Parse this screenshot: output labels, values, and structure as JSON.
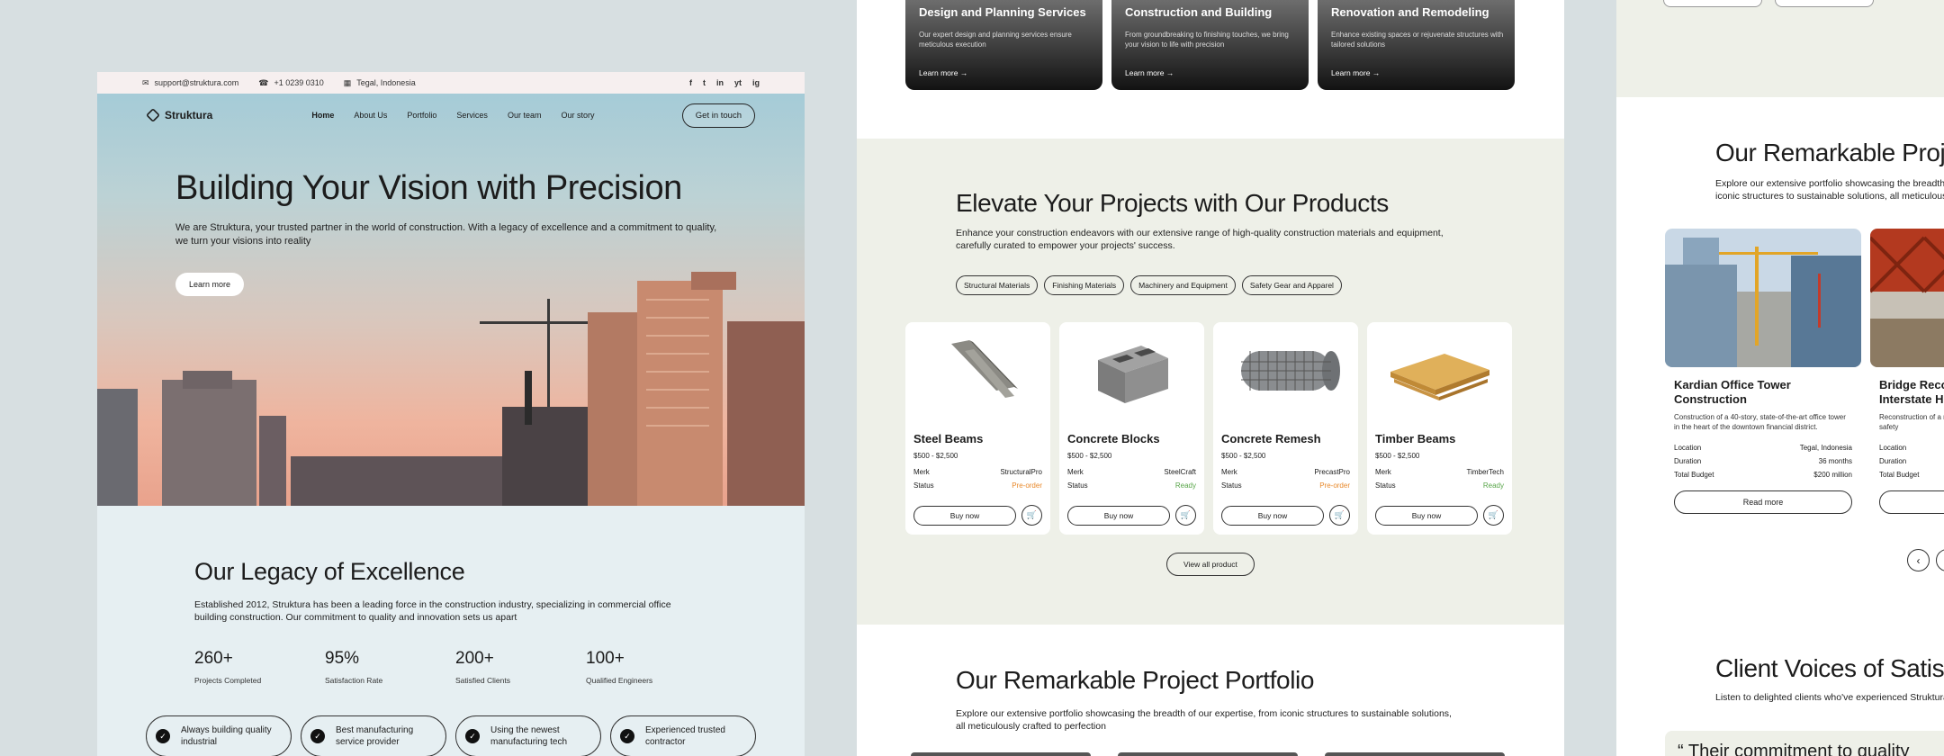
{
  "hero_page": {
    "topbar": {
      "email": "support@struktura.com",
      "phone": "+1 0239 0310",
      "location": "Tegal, Indonesia",
      "socials": [
        "f",
        "t",
        "in",
        "yt",
        "ig"
      ]
    },
    "nav": {
      "brand": "Struktura",
      "links": [
        "Home",
        "About Us",
        "Portfolio",
        "Services",
        "Our team",
        "Our story"
      ],
      "cta": "Get in touch"
    },
    "hero": {
      "title": "Building Your Vision with Precision",
      "subtitle": "We are Struktura, your trusted partner in the world of construction. With a legacy of excellence and a commitment to quality, we turn your visions into reality",
      "button": "Learn more"
    },
    "legacy": {
      "title": "Our Legacy of Excellence",
      "description": "Established 2012, Struktura has been a leading force in the construction industry, specializing in commercial office building construction. Our commitment to quality and innovation sets us apart",
      "stats": [
        {
          "value": "260+",
          "label": "Projects Completed"
        },
        {
          "value": "95%",
          "label": "Satisfaction Rate"
        },
        {
          "value": "200+",
          "label": "Satisfied Clients"
        },
        {
          "value": "100+",
          "label": "Qualified Engineers"
        }
      ],
      "highlights": [
        "Always building quality industrial",
        "Best manufacturing service provider",
        "Using the newest manufacturing tech",
        "Experienced trusted contractor"
      ]
    }
  },
  "products_page": {
    "services": [
      {
        "title": "Design and Planning Services",
        "text": "Our expert design and planning services ensure meticulous execution",
        "more": "Learn more"
      },
      {
        "title": "Construction and Building",
        "text": "From groundbreaking to finishing touches, we bring your vision to life with precision",
        "more": "Learn more"
      },
      {
        "title": "Renovation and Remodeling",
        "text": "Enhance existing spaces or rejuvenate structures with tailored solutions",
        "more": "Learn more"
      }
    ],
    "title": "Elevate Your Projects with Our Products",
    "description": "Enhance your construction endeavors with our extensive range of high-quality construction materials and equipment, carefully curated to empower your projects' success.",
    "categories": [
      "Structural Materials",
      "Finishing Materials",
      "Machinery and Equipment",
      "Safety Gear and Apparel"
    ],
    "products": [
      {
        "name": "Steel Beams",
        "price": "$500 - $2,500",
        "merk": "StructuralPro",
        "status": "Pre-order",
        "status_color": "#e8892b"
      },
      {
        "name": "Concrete Blocks",
        "price": "$500 - $2,500",
        "merk": "SteelCraft",
        "status": "Ready",
        "status_color": "#5aa64b"
      },
      {
        "name": "Concrete Remesh",
        "price": "$500 - $2,500",
        "merk": "PrecastPro",
        "status": "Pre-order",
        "status_color": "#e8892b"
      },
      {
        "name": "Timber Beams",
        "price": "$500 - $2,500",
        "merk": "TimberTech",
        "status": "Ready",
        "status_color": "#5aa64b"
      }
    ],
    "labels": {
      "merk": "Merk",
      "status": "Status",
      "buy": "Buy now"
    },
    "view_all": "View all product",
    "portfolio_title": "Our Remarkable Project Portfolio",
    "portfolio_desc": "Explore our extensive portfolio showcasing the breadth of our expertise, from iconic structures to sustainable solutions, all meticulously crafted to perfection"
  },
  "portfolio_page": {
    "title": "Our Remarkable Project Portfolio",
    "description": "Explore our extensive portfolio showcasing the breadth of our expertise, from iconic structures to sustainable solutions, all meticulously crafted to perfection",
    "projects": [
      {
        "name": "Kardian Office Tower Construction",
        "desc": "Construction of a 40-story, state-of-the-art office tower in the heart of the downtown financial district.",
        "location": "Tegal, Indonesia",
        "duration": "36 months",
        "budget": "$200 million"
      },
      {
        "name": "Bridge Reconstruction Interstate Highway",
        "desc": "Reconstruction of a major highway bridge to improve safety",
        "location": "",
        "duration": "",
        "budget": ""
      }
    ],
    "labels": {
      "location": "Location",
      "duration": "Duration",
      "budget": "Total Budget",
      "read_more": "Read more"
    },
    "testimonials_title": "Client Voices of Satisfaction",
    "testimonials_desc": "Listen to delighted clients who've experienced Struktura",
    "quote_start": "Their commitment to quality"
  }
}
